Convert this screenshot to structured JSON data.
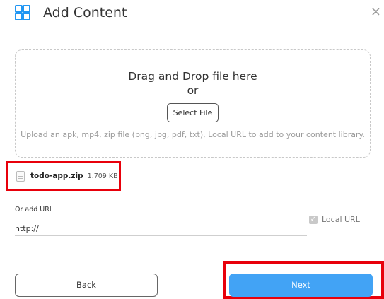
{
  "header": {
    "title": "Add Content",
    "icon": "grid-icon",
    "close_glyph": "×"
  },
  "dropzone": {
    "title": "Drag and Drop file here",
    "or": "or",
    "select_label": "Select File",
    "hint": "Upload an apk, mp4, zip file (png, jpg, pdf, txt), Local URL to add to your content library."
  },
  "file": {
    "name": "todo-app.zip",
    "size": "1.709 KB",
    "icon": "file-icon",
    "highlight_color": "#e8000b"
  },
  "url": {
    "label": "Or add URL",
    "value": "http://",
    "local_label": "Local URL",
    "local_checked": true
  },
  "footer": {
    "back_label": "Back",
    "next_label": "Next"
  },
  "colors": {
    "accent": "#2196f3",
    "next_button": "#42a3f5",
    "annotation_red": "#e8000b"
  }
}
